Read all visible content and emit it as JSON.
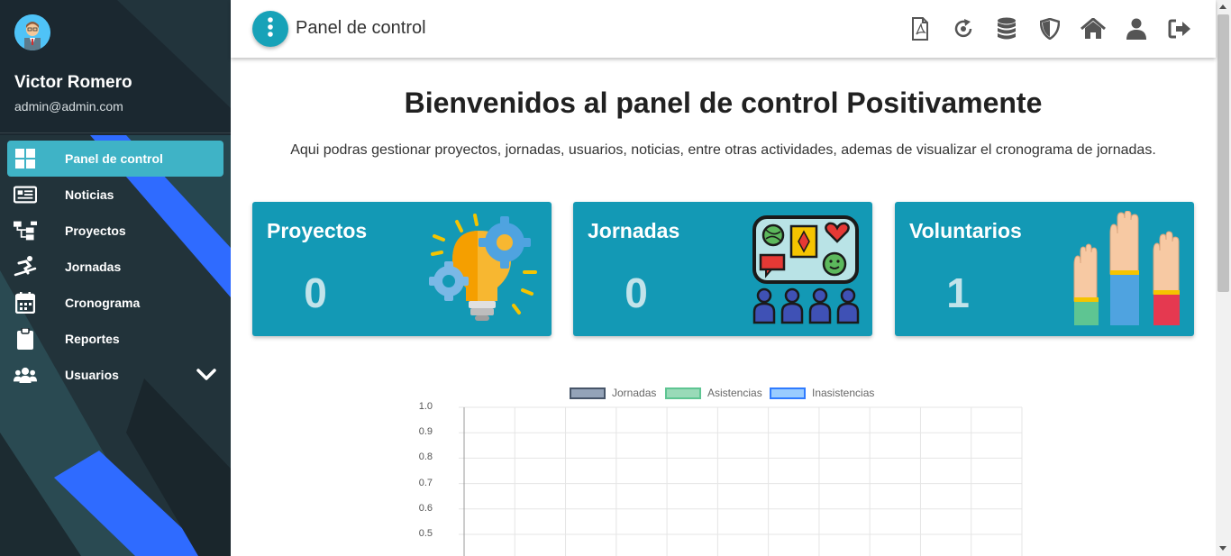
{
  "user": {
    "name": "Victor Romero",
    "email": "admin@admin.com"
  },
  "sidebar": {
    "items": [
      {
        "label": "Panel de control",
        "icon": "dashboard-icon",
        "active": true
      },
      {
        "label": "Noticias",
        "icon": "newspaper-icon"
      },
      {
        "label": "Proyectos",
        "icon": "sitemap-icon"
      },
      {
        "label": "Jornadas",
        "icon": "snowboarding-icon"
      },
      {
        "label": "Cronograma",
        "icon": "calendar-icon"
      },
      {
        "label": "Reportes",
        "icon": "clipboard-icon"
      },
      {
        "label": "Usuarios",
        "icon": "users-icon",
        "expandable": true
      }
    ]
  },
  "topbar": {
    "title": "Panel de control",
    "icons": [
      "file-pdf-icon",
      "refresh-icon",
      "database-icon",
      "shield-icon",
      "home-icon",
      "user-icon",
      "logout-icon"
    ]
  },
  "main": {
    "welcome": "Bienvenidos al panel de control Positivamente",
    "subtitle": "Aqui podras gestionar proyectos, jornadas, usuarios, noticias, entre otras actividades, ademas de visualizar el cronograma de jornadas."
  },
  "cards": [
    {
      "title": "Proyectos",
      "value": "0",
      "icon": "lightbulb-gears-icon"
    },
    {
      "title": "Jornadas",
      "value": "0",
      "icon": "meeting-board-icon"
    },
    {
      "title": "Voluntarios",
      "value": "1",
      "icon": "raised-hands-icon"
    }
  ],
  "colors": {
    "sidebar_bg": "#1d2a30",
    "sidebar_accent": "#2f6bff",
    "active_item": "#3fb3c6",
    "card_bg": "#1399b5",
    "card_value": "#c2e3ea"
  },
  "chart_data": {
    "type": "bar",
    "series": [
      {
        "name": "Jornadas",
        "color": "#475569",
        "fill": "#94a3b8",
        "values": []
      },
      {
        "name": "Asistencias",
        "color": "#5ec592",
        "fill": "#99dab8",
        "values": []
      },
      {
        "name": "Inasistencias",
        "color": "#2f7bff",
        "fill": "#99ccff",
        "values": []
      }
    ],
    "y_ticks": [
      "1.0",
      "0.9",
      "0.8",
      "0.7",
      "0.6",
      "0.5"
    ],
    "ylim": [
      0,
      1
    ],
    "grid": true,
    "legend": "top"
  }
}
